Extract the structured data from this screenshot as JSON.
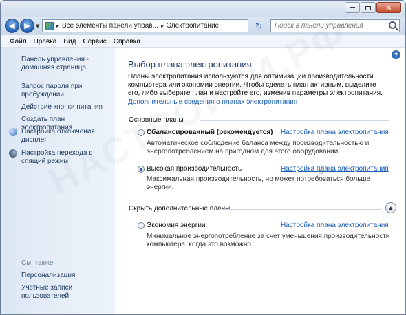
{
  "addressbar": {
    "crumb1": "Все элементы панели управ...",
    "crumb2": "Электропитание",
    "search_placeholder": "Поиск в панели управления"
  },
  "menu": [
    "Файл",
    "Правка",
    "Вид",
    "Сервис",
    "Справка"
  ],
  "sidebar": {
    "home_line1": "Панель управления -",
    "home_line2": "домашняя страница",
    "items": [
      {
        "line1": "Запрос пароля при",
        "line2": "пробуждении"
      },
      {
        "line1": "Действие кнопки питания",
        "line2": ""
      },
      {
        "line1": "Создать план электропитания",
        "line2": ""
      },
      {
        "line1": "Настройка отключения",
        "line2": "дисплея"
      },
      {
        "line1": "Настройка перехода в",
        "line2": "спящий режим"
      }
    ],
    "see_also": "См. также",
    "see_also_items": [
      {
        "line1": "Персонализация",
        "line2": ""
      },
      {
        "line1": "Учетные записи",
        "line2": "пользователей"
      }
    ]
  },
  "main": {
    "title": "Выбор плана электропитания",
    "intro_line1": "Планы электропитания используются для оптимизации производительности",
    "intro_line2": "компьютера или экономии энергии. Чтобы сделать план активным, выделите",
    "intro_line3": "его, либо выберите план и настройте его, изменив параметры электропитания.",
    "more_link": "Дополнительные сведения о планах электропитания",
    "group_main": "Основные планы",
    "group_hidden": "Скрыть дополнительные планы",
    "plans": [
      {
        "name": "Сбалансированный (рекомендуется)",
        "setup": "Настройка плана электропитания",
        "desc1": "Автоматическое соблюдение баланса между производительностью и",
        "desc2": "энергопотреблением на пригодном для этого оборудовании.",
        "selected": false
      },
      {
        "name": "Высокая производительность",
        "setup": "Настройка плана электропитания",
        "desc1": "Максимальная производительность, но может потребоваться больше",
        "desc2": "энергии.",
        "selected": true
      },
      {
        "name": "Экономия энергии",
        "setup": "Настройка плана электропитания",
        "desc1": "Минимальное энергопотребление за счет уменьшения производительности",
        "desc2": "компьютера, когда это возможно.",
        "selected": false
      }
    ]
  },
  "watermark": "НАСТРОЙКИ.РФ",
  "colors": {
    "link": "#1a5fb4",
    "title": "#1f3d6e",
    "sidebar_bg": "#dde8f5"
  },
  "icons": {
    "nav": [
      "back-arrow-icon",
      "forward-arrow-icon"
    ],
    "sidebar": [
      "moon-icon",
      "monitor-icon",
      "sleep-icon"
    ],
    "other": [
      "search-icon",
      "help-icon",
      "refresh-icon",
      "collapse-icon",
      "cursor-hand-icon"
    ]
  }
}
